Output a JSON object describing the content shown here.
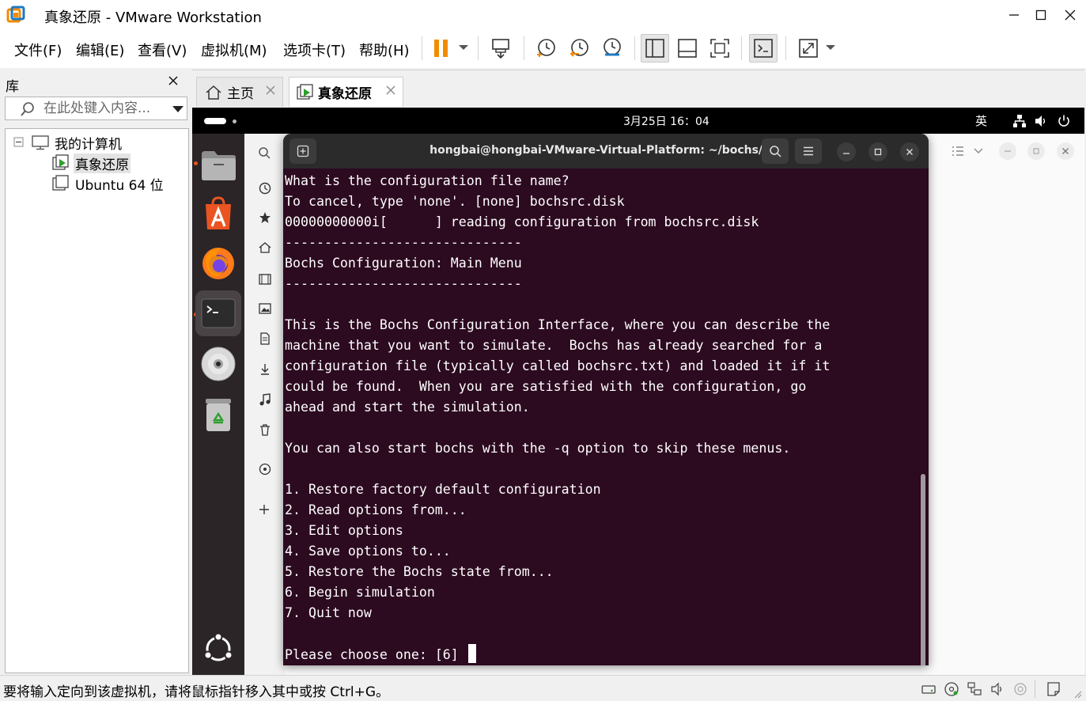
{
  "window": {
    "title": "真象还原 - VMware Workstation"
  },
  "menu": [
    "文件(F)",
    "编辑(E)",
    "查看(V)",
    "虚拟机(M)",
    "选项卡(T)",
    "帮助(H)"
  ],
  "library": {
    "title": "库",
    "search_placeholder": "在此处键入内容...",
    "tree": [
      {
        "label": "我的计算机"
      },
      {
        "label": "真象还原"
      },
      {
        "label": "Ubuntu 64 位"
      }
    ]
  },
  "tabs": [
    {
      "label": "主页"
    },
    {
      "label": "真象还原"
    }
  ],
  "guest": {
    "clock": "3月25日 16：04",
    "input_method": "英"
  },
  "terminal": {
    "title": "hongbai@hongbai-VMware-Virtual-Platform: ~/bochs/bin",
    "lines": [
      "What is the configuration file name?",
      "To cancel, type 'none'. [none] bochsrc.disk",
      "00000000000i[      ] reading configuration from bochsrc.disk",
      "------------------------------",
      "Bochs Configuration: Main Menu",
      "------------------------------",
      "",
      "This is the Bochs Configuration Interface, where you can describe the",
      "machine that you want to simulate.  Bochs has already searched for a",
      "configuration file (typically called bochsrc.txt) and loaded it if it",
      "could be found.  When you are satisfied with the configuration, go",
      "ahead and start the simulation.",
      "",
      "You can also start bochs with the -q option to skip these menus.",
      "",
      "1. Restore factory default configuration",
      "2. Read options from...",
      "3. Edit options",
      "4. Save options to...",
      "5. Restore the Bochs state from...",
      "6. Begin simulation",
      "7. Quit now",
      "",
      "Please choose one: [6] "
    ]
  },
  "status": {
    "message": "要将输入定向到该虚拟机，请将鼠标指针移入其中或按 Ctrl+G。"
  },
  "colors": {
    "terminal_bg": "#2c0a20",
    "ubuntu_orange": "#e95420",
    "vmware_orange": "#f38b00"
  }
}
